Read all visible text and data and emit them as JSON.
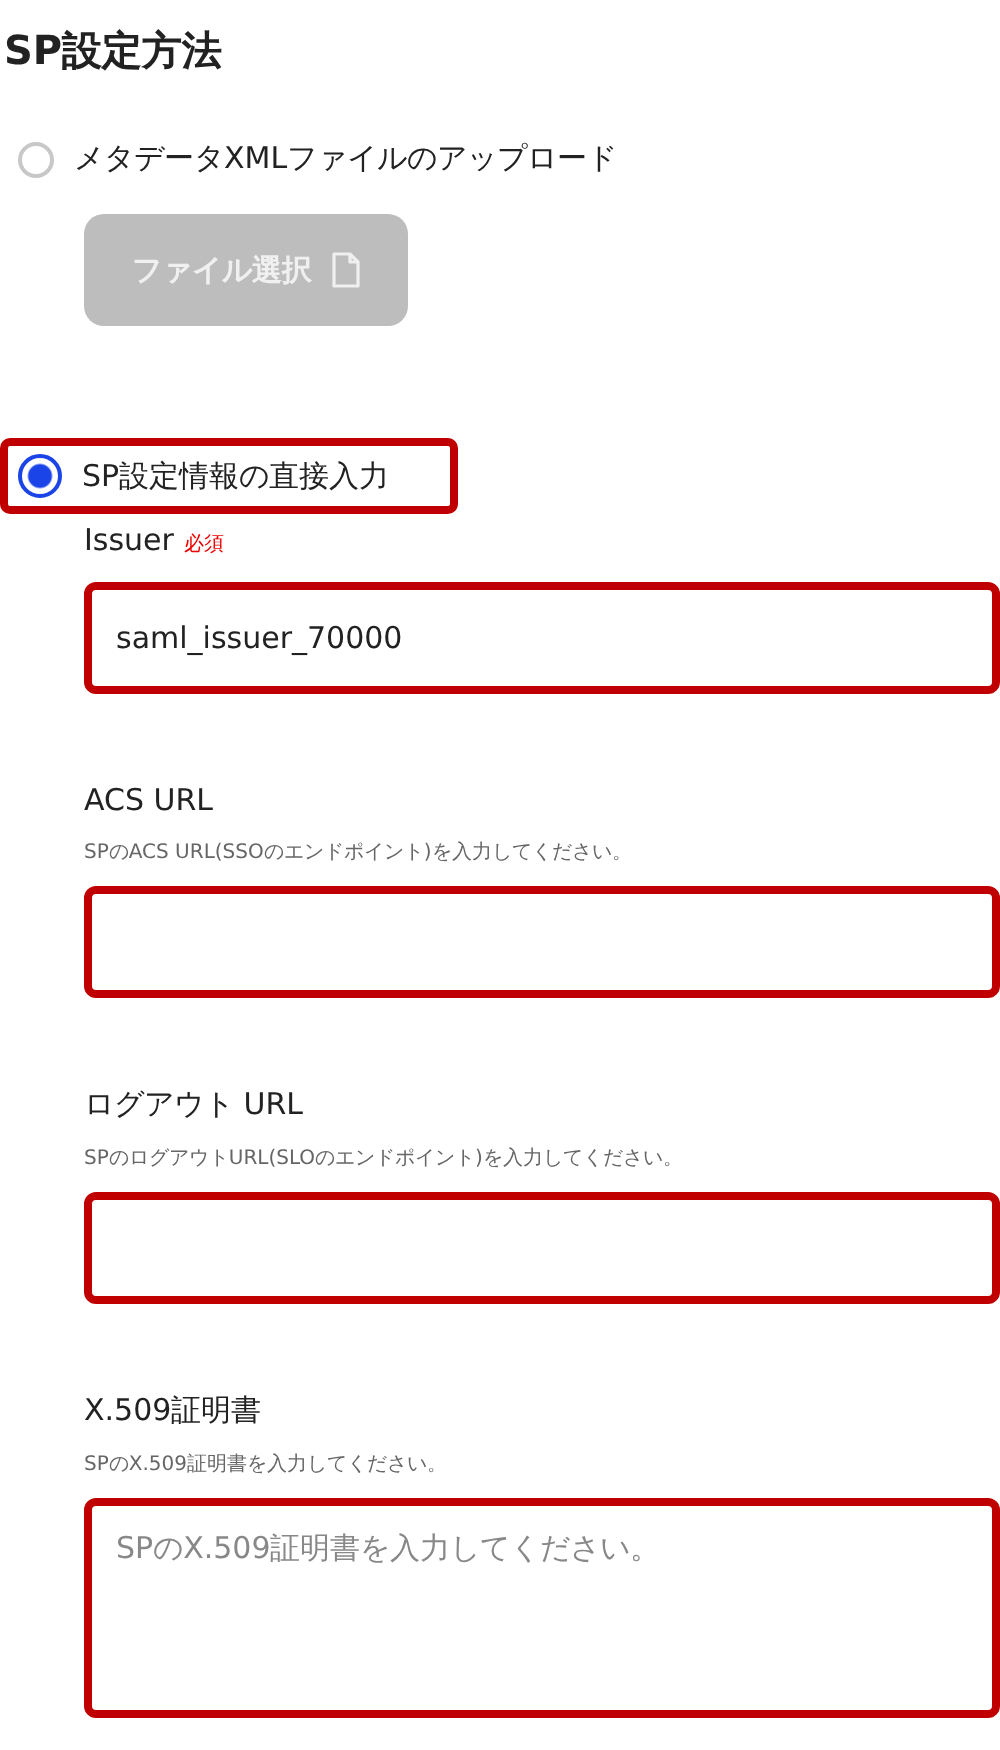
{
  "title": "SP設定方法",
  "options": [
    {
      "label": "メタデータXMLファイルのアップロード",
      "selected": false,
      "highlighted": false,
      "button": {
        "label": "ファイル選択",
        "disabled": true
      }
    },
    {
      "label": "SP設定情報の直接入力",
      "selected": true,
      "highlighted": true
    }
  ],
  "fields": [
    {
      "kind": "input",
      "label": "Issuer",
      "required": "必須",
      "value": "saml_issuer_70000",
      "highlighted": true
    },
    {
      "kind": "input",
      "label": "ACS URL",
      "help": "SPのACS URL(SSOのエンドポイント)を入力してください。",
      "highlighted": true
    },
    {
      "kind": "input",
      "label": "ログアウト URL",
      "help": "SPのログアウトURL(SLOのエンドポイント)を入力してください。",
      "highlighted": true
    },
    {
      "kind": "textarea",
      "label": "X.509証明書",
      "help": "SPのX.509証明書を入力してください。",
      "placeholder": "SPのX.509証明書を入力してください。",
      "highlighted": true
    }
  ]
}
